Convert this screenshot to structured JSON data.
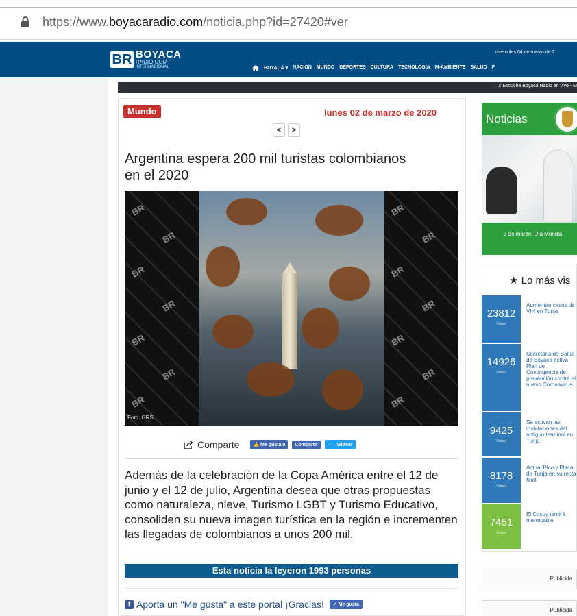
{
  "browser": {
    "url_prefix": "https://www.",
    "url_domain": "boyacaradio.com",
    "url_path": "/noticia.php?id=27420#ver"
  },
  "site": {
    "logo_br": "BR",
    "logo_line1": "BOYACA",
    "logo_line2": "RADIO.COM",
    "logo_line3": "INTERNACIONAL",
    "date": "miércoles 04 de marzo de 2",
    "nav": [
      "BOYACÁ ▾",
      "NACIÓN",
      "MUNDO",
      "DEPORTES",
      "CULTURA",
      "TECNOLOGÍA",
      "M-AMBIENTE",
      "SALUD",
      "F"
    ],
    "radio_strip": "Escucha Boyacá Radio en vivo - M"
  },
  "article": {
    "category": "Mundo",
    "date": "lunes 02 de marzo de 2020",
    "pager_prev": "<",
    "pager_next": ">",
    "headline": "Argentina espera 200 mil turistas colombianos en el 2020",
    "photo_credit": "Foto: GRS",
    "share_label": "Comparte",
    "fb_like": "Me gusta 9",
    "fb_share": "Compartir",
    "tweet": "Twittear",
    "body": "Además de la celebración de la Copa América entre el 12 de junio y el 12 de julio, Argentina desea que otras propuestas como naturaleza, nieve, Turismo LGBT y Turismo Educativo, consoliden su nueva imagen turística en la región e incrementen las llegadas de colombianos a unos 200 mil.",
    "read_count": "Esta noticia la leyeron 1993 personas",
    "aporta": "Aporta un \"Me gusta\" a este portal ¡Gracias!",
    "megusta_btn": "Me gusta"
  },
  "sidebar": {
    "noticias_title": "Noticias",
    "noticias_caption": "3 de marzo: Día Mundia",
    "mas_vistas": "Lo más vis",
    "visitas_label": "Visitas",
    "ranking": [
      {
        "count": "23812",
        "title": "Aumentan casos de VIH en Tunja",
        "color": "#2f79b9"
      },
      {
        "count": "14926",
        "title": "Secretaria de Salud de Boyacá activa Plan de Contingencia de prevención contra el nuevo Coronavirus",
        "color": "#2f79b9"
      },
      {
        "count": "9425",
        "title": "Se activan las instalaciones del antiguo terminal en Tunja",
        "color": "#2f79b9"
      },
      {
        "count": "8178",
        "title": "Actual Pico y Placa de Tunja en su recta final",
        "color": "#2f79b9"
      },
      {
        "count": "7451",
        "title": "El Cocuy tendrá metrocable",
        "color": "#7cc142"
      }
    ],
    "pub1": "Publicida",
    "pub2": "Publicida"
  }
}
